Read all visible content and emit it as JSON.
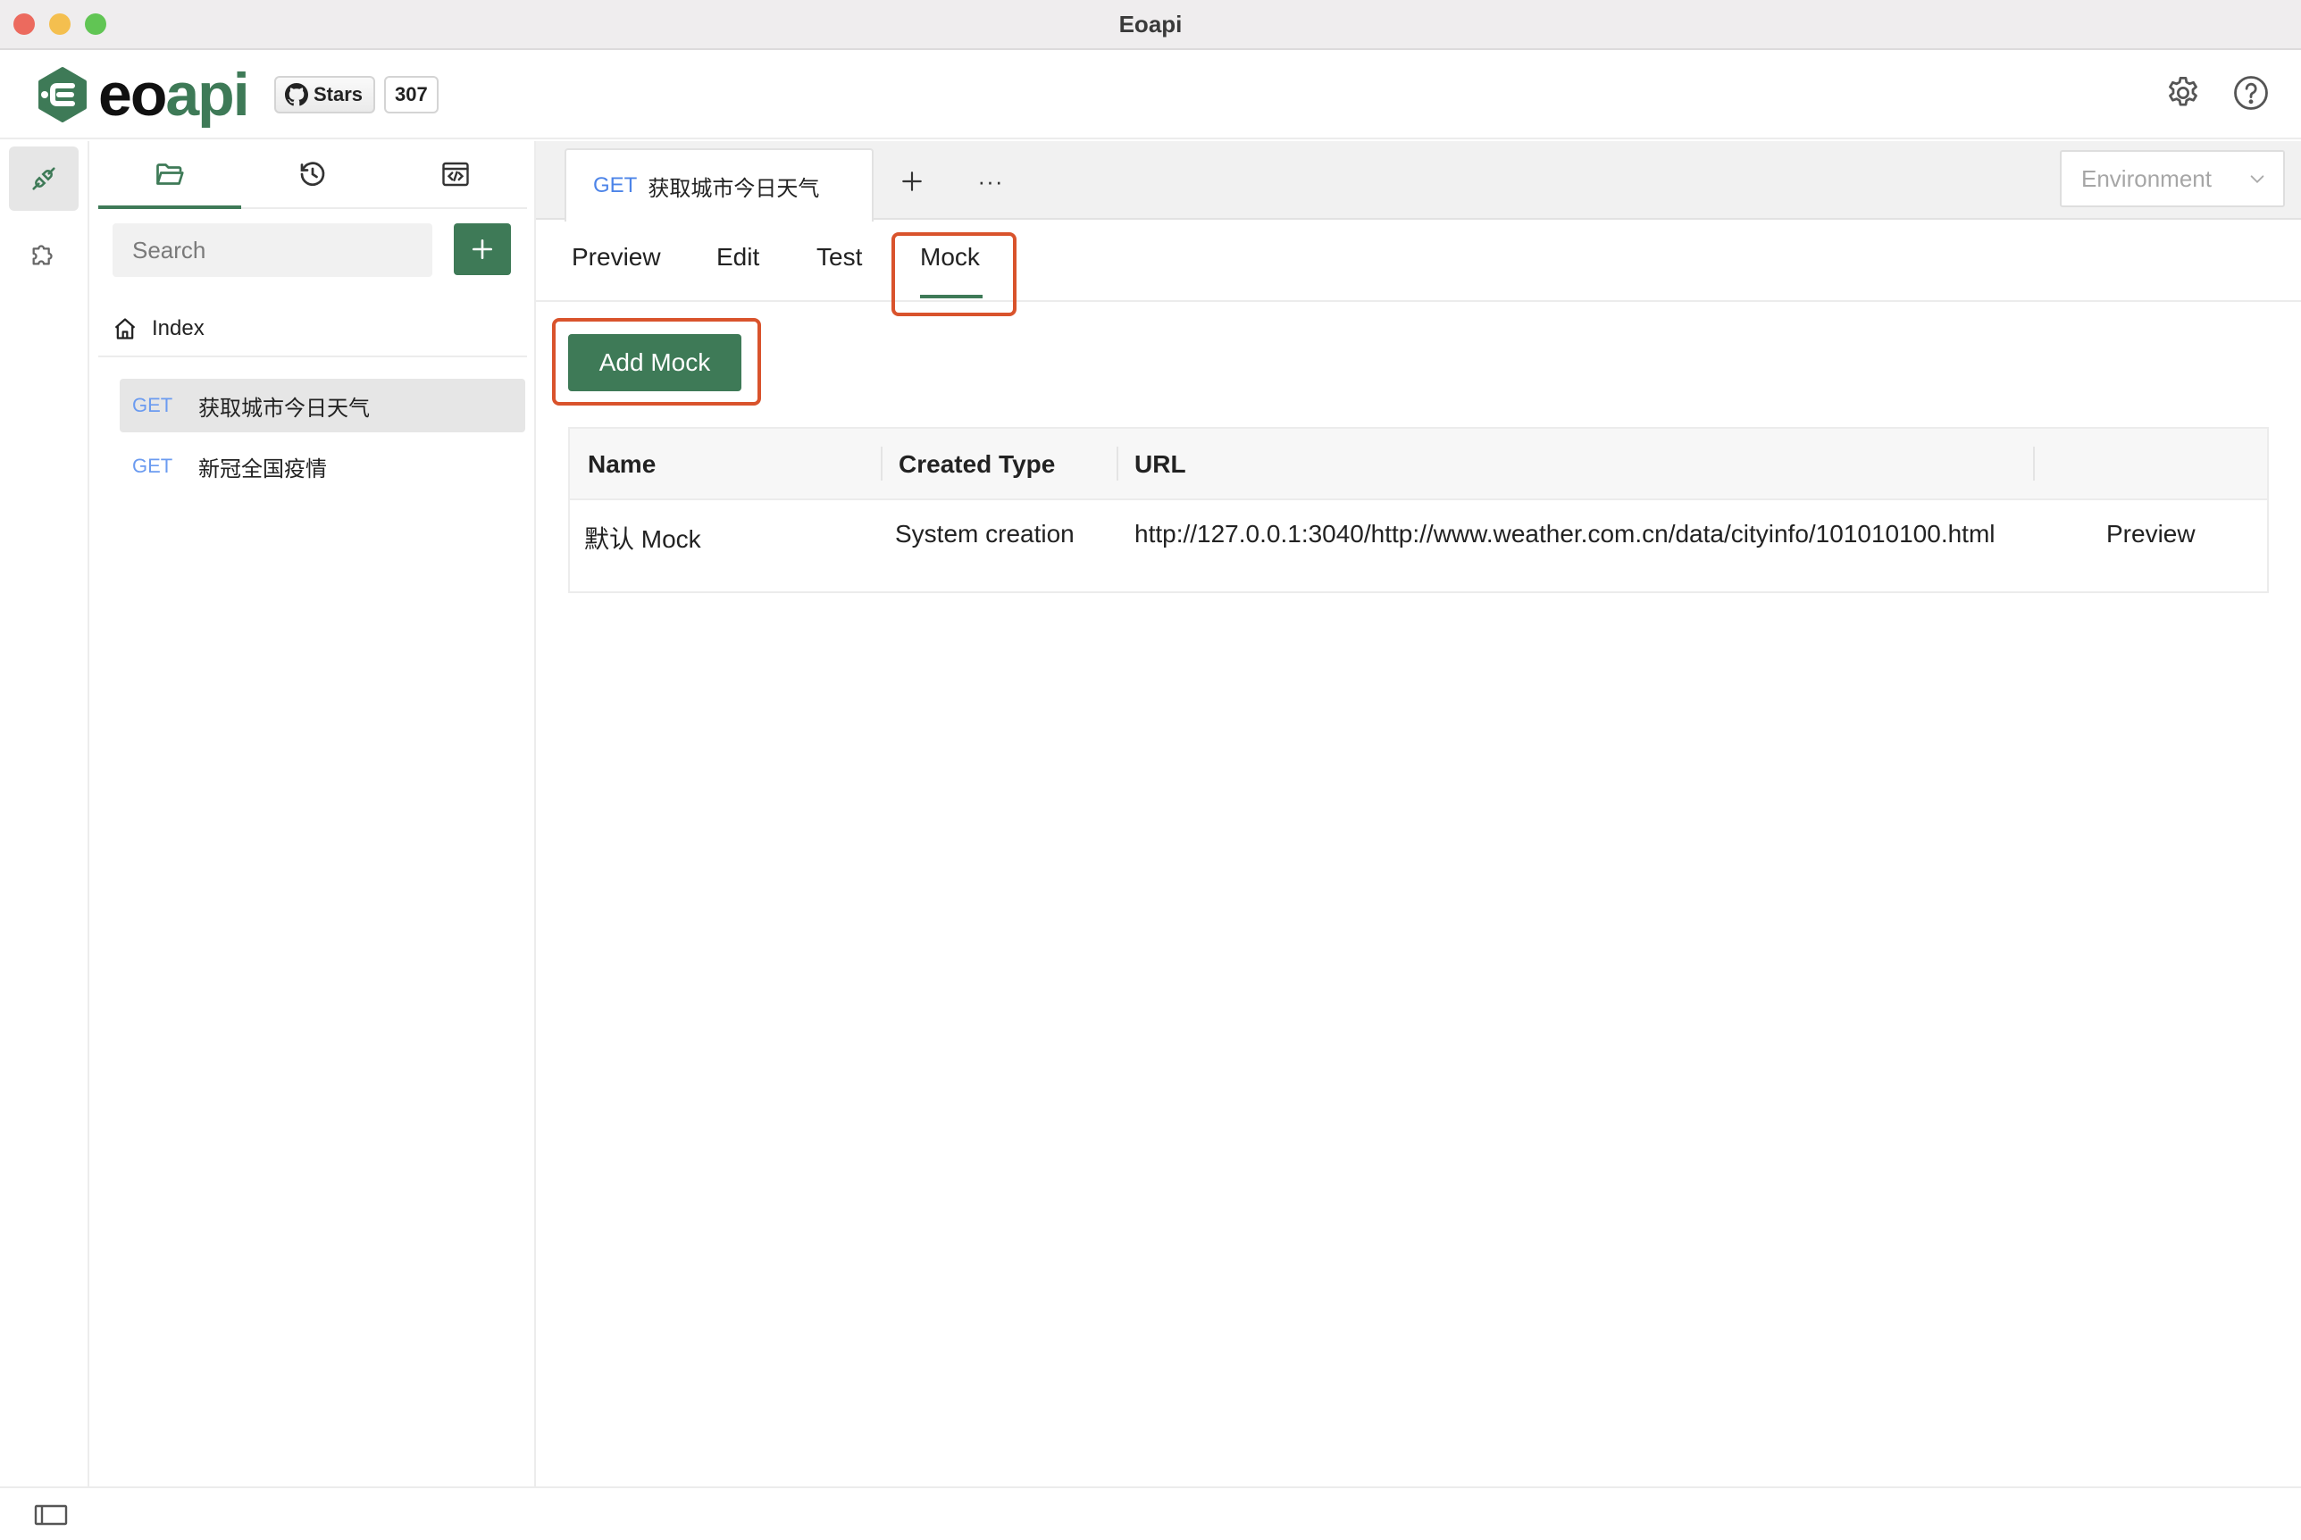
{
  "window": {
    "title": "Eoapi"
  },
  "header": {
    "logo_text_dark": "eo",
    "logo_text_accent": "api",
    "github": {
      "stars_label": "Stars",
      "stars_count": "307"
    },
    "icons": [
      "settings-icon",
      "help-icon"
    ]
  },
  "rail": {
    "items": [
      {
        "icon": "api-plug-icon",
        "active": true
      },
      {
        "icon": "plugin-puzzle-icon",
        "active": false
      }
    ]
  },
  "sidebar": {
    "tabs": [
      {
        "icon": "folder-icon",
        "active": true
      },
      {
        "icon": "history-icon",
        "active": false
      },
      {
        "icon": "code-window-icon",
        "active": false
      }
    ],
    "search": {
      "placeholder": "Search"
    },
    "add_button_label": "+",
    "index_label": "Index",
    "apis": [
      {
        "method": "GET",
        "name": "获取城市今日天气",
        "selected": true
      },
      {
        "method": "GET",
        "name": "新冠全国疫情",
        "selected": false
      }
    ]
  },
  "main": {
    "open_tab": {
      "method": "GET",
      "name": "获取城市今日天气"
    },
    "new_tab_label": "+",
    "more_label": "···",
    "environment": {
      "placeholder": "Environment"
    },
    "subtabs": [
      "Preview",
      "Edit",
      "Test",
      "Mock"
    ],
    "active_subtab": "Mock",
    "add_mock_label": "Add Mock",
    "mock_table": {
      "columns": [
        "Name",
        "Created Type",
        "URL",
        ""
      ],
      "rows": [
        {
          "name": "默认 Mock",
          "created_type": "System creation",
          "url": "http://127.0.0.1:3040/http://www.weather.com.cn/data/cityinfo/101010100.html",
          "action": "Preview"
        }
      ]
    }
  },
  "colors": {
    "accent": "#3e7a57",
    "highlight": "#d9532c",
    "method_get": "#4d84e8"
  },
  "footer": {
    "icon": "sidebar-toggle-icon"
  }
}
